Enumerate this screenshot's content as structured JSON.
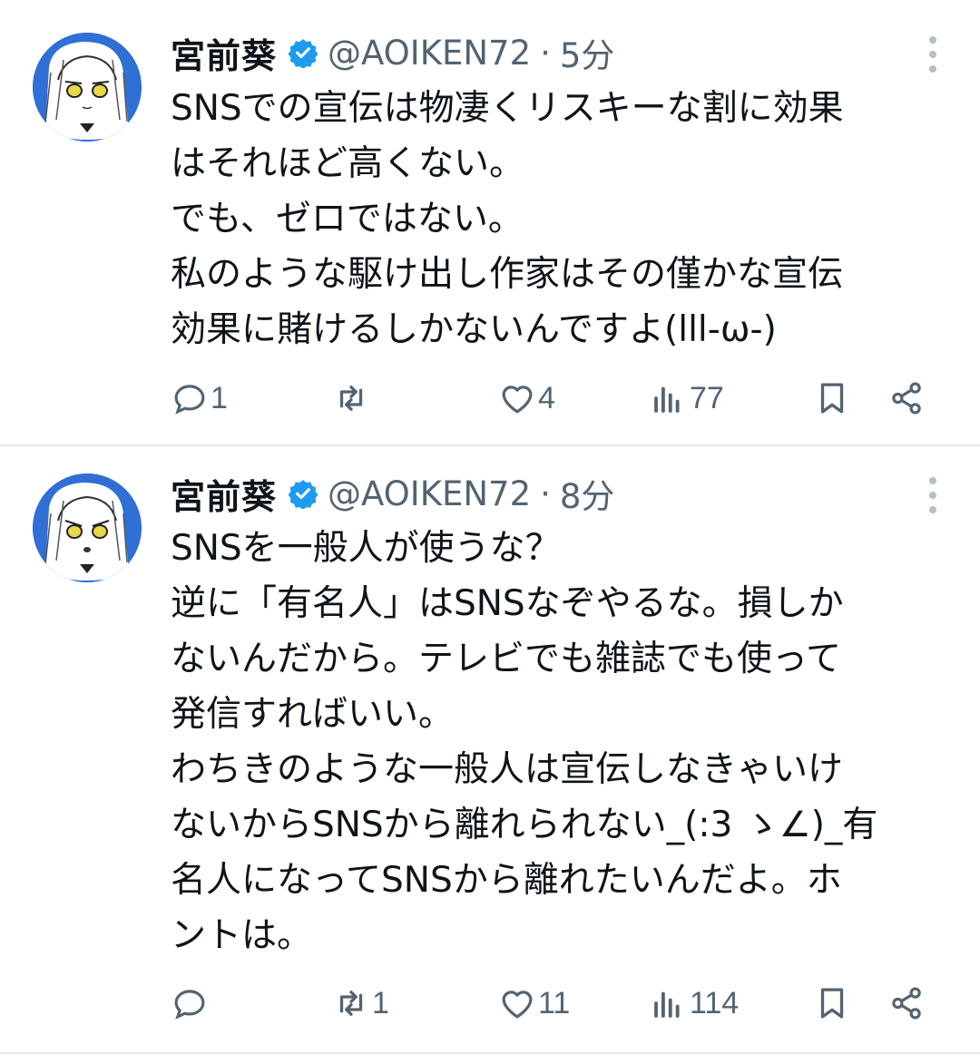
{
  "tweets": [
    {
      "name": "宮前葵",
      "handle": "@AOIKEN72",
      "separator": "·",
      "time": "5分",
      "lines": [
        "SNSでの宣伝は物凄くリスキーな割に効果",
        "はそれほど高くない。",
        "でも、ゼロではない。",
        "私のような駆け出し作家はその僅かな宣伝",
        "効果に賭けるしかないんですよ(lll-ω-)"
      ],
      "replies": "1",
      "retweets": "",
      "likes": "4",
      "views": "77"
    },
    {
      "name": "宮前葵",
      "handle": "@AOIKEN72",
      "separator": "·",
      "time": "8分",
      "lines": [
        "SNSを一般人が使うな？",
        "逆に「有名人」はSNSなぞやるな。損しか",
        "ないんだから。テレビでも雑誌でも使って",
        "発信すればいい。",
        "わちきのような一般人は宣伝しなきゃいけ",
        "ないからSNSから離れられない_(:3 ゝ∠)_有",
        "名人になってSNSから離れたいんだよ。ホ",
        "ントは。"
      ],
      "replies": "",
      "retweets": "1",
      "likes": "11",
      "views": "114"
    }
  ],
  "icons": [
    "verified-badge-icon",
    "more-options-icon",
    "reply-icon",
    "retweet-icon",
    "like-icon",
    "views-icon",
    "bookmark-icon",
    "share-icon"
  ],
  "colors": {
    "verified": "#1d9bf0",
    "icon_gray": "#536471",
    "avatar_ring": "#2f6fd6"
  }
}
